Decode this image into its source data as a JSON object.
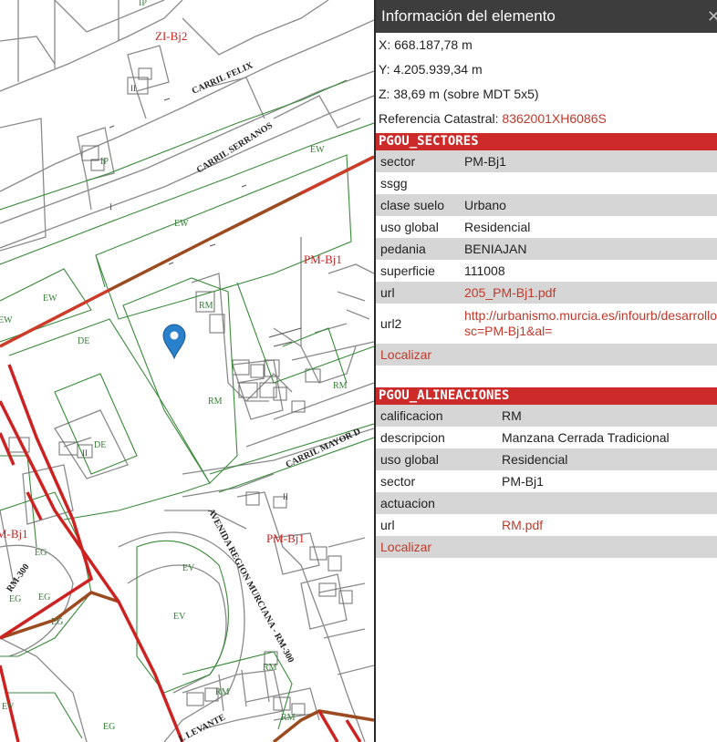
{
  "panel": {
    "title": "Información del elemento",
    "close_icon": "close-icon",
    "x_coord": "X: 668.187,78 m",
    "y_coord": "Y: 4.205.939,34 m",
    "z_coord": "Z: 38,69 m (sobre MDT 5x5)",
    "ref_label": "Referencia Catastral: ",
    "ref_value": "8362001XH6086S",
    "sections": [
      {
        "title": "PGOU_SECTORES",
        "rows": [
          {
            "key": "sector",
            "value": "PM-Bj1"
          },
          {
            "key": "ssgg",
            "value": ""
          },
          {
            "key": "clase suelo",
            "value": "Urbano"
          },
          {
            "key": "uso global",
            "value": "Residencial"
          },
          {
            "key": "pedania",
            "value": "BENIAJAN"
          },
          {
            "key": "superficie",
            "value": "111008"
          },
          {
            "key": "url",
            "value": "205_PM-Bj1.pdf"
          },
          {
            "key": "url2",
            "value": "http://urbanismo.murcia.es/infourb/desarrollo",
            "value2": "sc=PM-Bj1&al="
          }
        ],
        "localizar": "Localizar"
      },
      {
        "title": "PGOU_ALINEACIONES",
        "rows": [
          {
            "key": "calificacion",
            "value": "RM"
          },
          {
            "key": "descripcion",
            "value": "Manzana Cerrada Tradicional"
          },
          {
            "key": "uso global",
            "value": "Residencial"
          },
          {
            "key": "sector",
            "value": "PM-Bj1"
          },
          {
            "key": "actuacion",
            "value": ""
          },
          {
            "key": "url",
            "value": "RM.pdf"
          }
        ],
        "localizar": "Localizar"
      }
    ]
  },
  "map": {
    "marker_icon": "map-pin-icon",
    "street_labels": [
      "CARRIL FELIX",
      "CARRIL SERRANOS",
      "CARRIL MAYOR D",
      "AVENIDA REGION MURCIANA - RM-300",
      "RM-300",
      "L LEVANTE"
    ],
    "sector_labels": [
      "ZI-Bj2",
      "PM-Bj1",
      "PM-Bj1",
      "M-Bj1"
    ],
    "zone_labels": [
      "IP",
      "EW",
      "EW",
      "EW",
      "EW",
      "DE",
      "DE",
      "RM",
      "RM",
      "RM",
      "EG",
      "EG",
      "EG",
      "EG",
      "EV",
      "EV",
      "EV",
      "RM",
      "RM",
      "RM",
      "EG",
      "IP",
      "II",
      "II",
      "I",
      "II"
    ],
    "colors": {
      "sector_line": "#cc2222",
      "road_line": "#9c4a20",
      "zone_line": "#3a8a3a",
      "parcel_line": "#8a8a8a",
      "marker": "#2a81cb"
    }
  }
}
